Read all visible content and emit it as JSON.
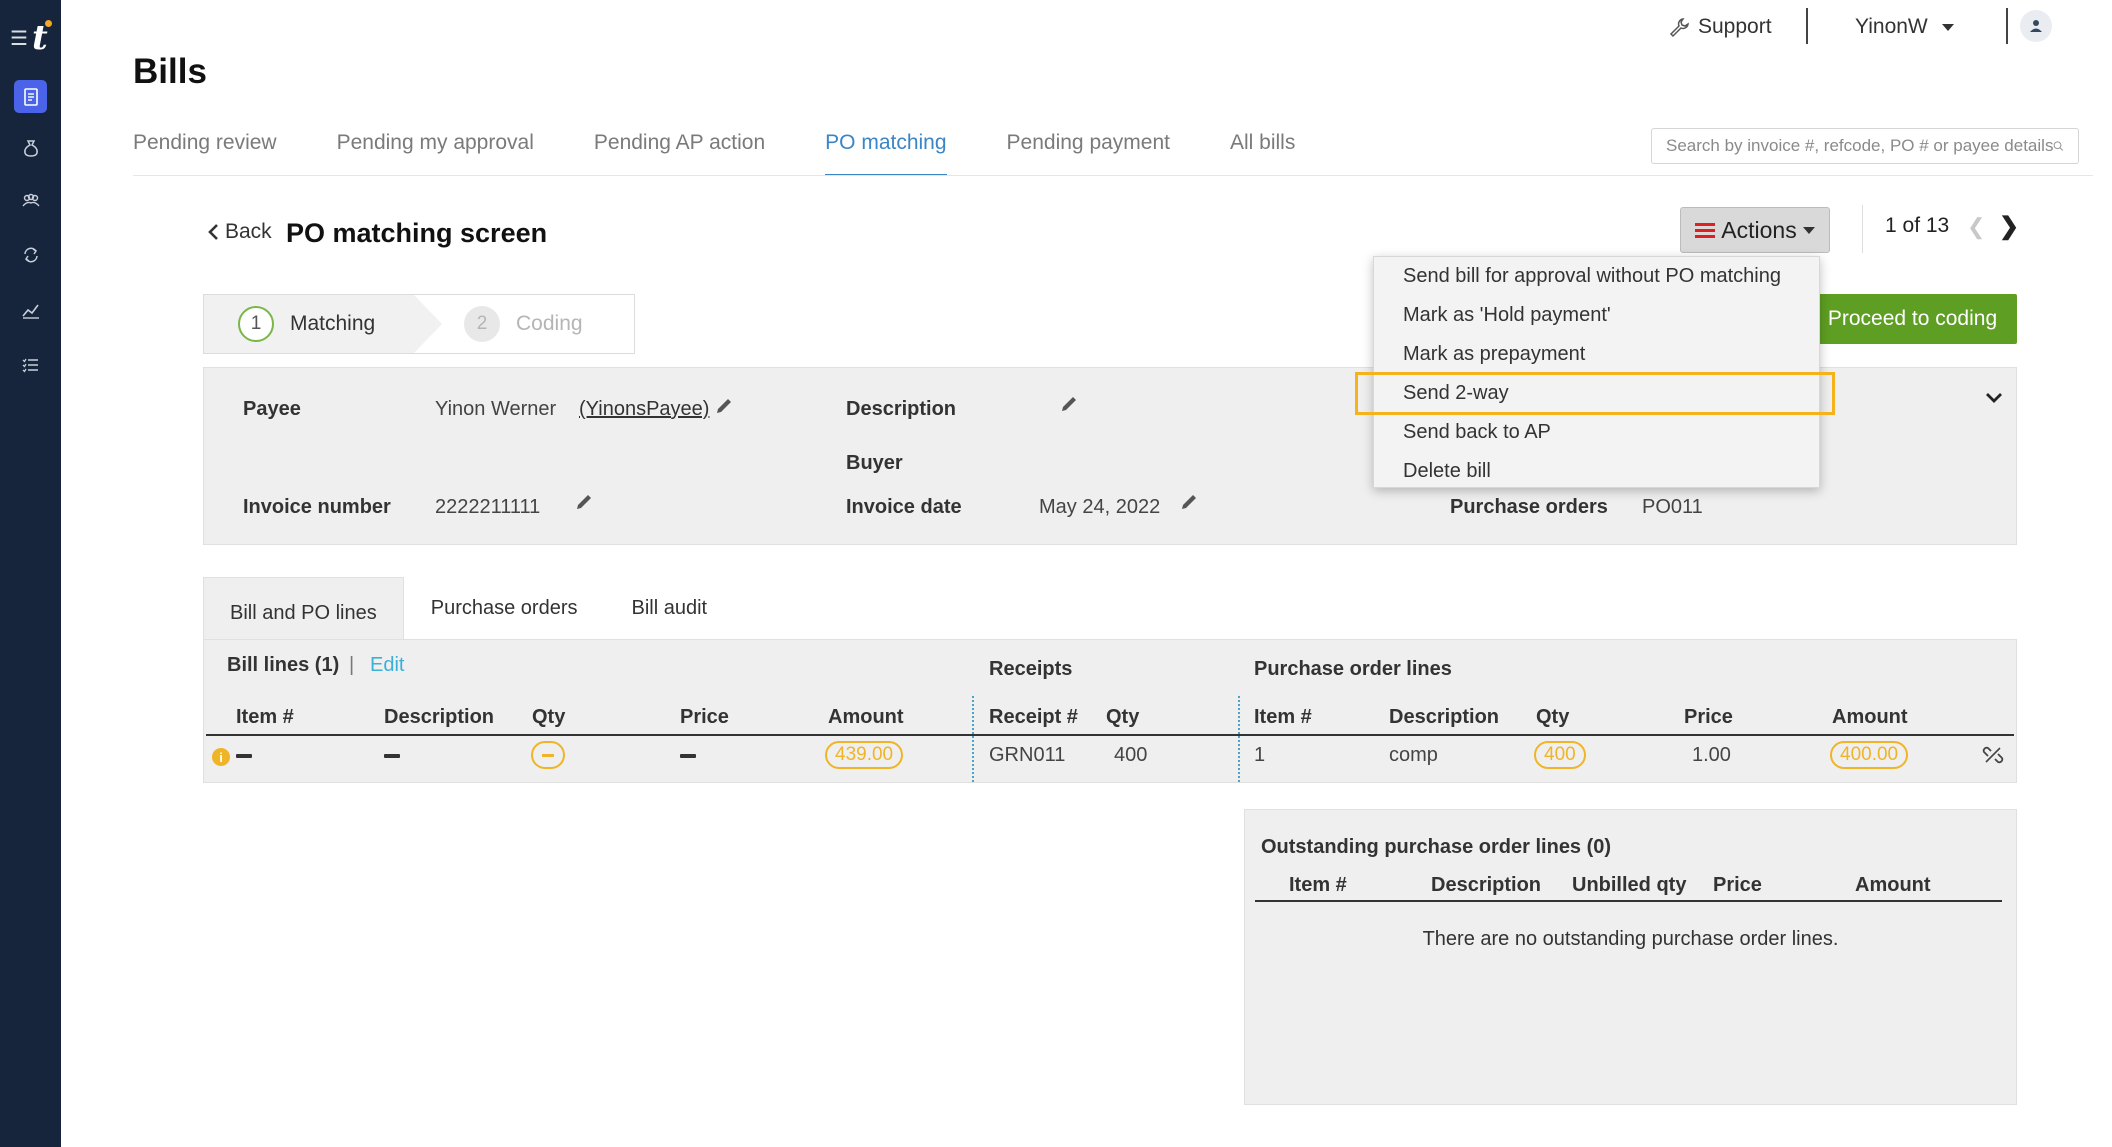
{
  "app": {
    "title": "Bills"
  },
  "header": {
    "support_label": "Support",
    "username": "YinonW"
  },
  "nav": {
    "items": [
      "bills",
      "payments",
      "payees",
      "sync",
      "reports",
      "tasks"
    ]
  },
  "tabs": [
    {
      "label": "Pending review",
      "active": false
    },
    {
      "label": "Pending my approval",
      "active": false
    },
    {
      "label": "Pending AP action",
      "active": false
    },
    {
      "label": "PO matching",
      "active": true
    },
    {
      "label": "Pending payment",
      "active": false
    },
    {
      "label": "All bills",
      "active": false
    }
  ],
  "search": {
    "placeholder": "Search by invoice #, refcode, PO # or payee details"
  },
  "subheader": {
    "back_label": "Back",
    "title": "PO matching screen",
    "actions_label": "Actions",
    "pager": "1 of 13"
  },
  "steps": [
    {
      "num": "1",
      "label": "Matching",
      "active": true
    },
    {
      "num": "2",
      "label": "Coding",
      "active": false
    }
  ],
  "proceed_label": "Proceed to coding",
  "details": {
    "payee_label": "Payee",
    "payee_name": "Yinon Werner",
    "payee_code": "(YinonsPayee)",
    "description_label": "Description",
    "buyer_label": "Buyer",
    "invoice_number_label": "Invoice number",
    "invoice_number": "2222211111",
    "invoice_date_label": "Invoice date",
    "invoice_date": "May 24, 2022",
    "purchase_orders_label": "Purchase orders",
    "purchase_orders": "PO011"
  },
  "lower_tabs": [
    {
      "label": "Bill and PO lines",
      "active": true
    },
    {
      "label": "Purchase orders",
      "active": false
    },
    {
      "label": "Bill audit",
      "active": false
    }
  ],
  "lines": {
    "bill_lines_title": "Bill lines (1)",
    "edit_label": "Edit",
    "receipts_title": "Receipts",
    "po_lines_title": "Purchase order lines",
    "bill_cols": [
      "Item #",
      "Description",
      "Qty",
      "Price",
      "Amount"
    ],
    "receipt_cols": [
      "Receipt #",
      "Qty"
    ],
    "po_cols": [
      "Item #",
      "Description",
      "Qty",
      "Price",
      "Amount"
    ],
    "row": {
      "bill_amount": "439.00",
      "receipt_no": "GRN011",
      "receipt_qty": "400",
      "po_item": "1",
      "po_description": "comp",
      "po_qty": "400",
      "po_price": "1.00",
      "po_amount": "400.00"
    }
  },
  "outstanding": {
    "title": "Outstanding purchase order lines (0)",
    "cols": [
      "Item #",
      "Description",
      "Unbilled qty",
      "Price",
      "Amount"
    ],
    "empty": "There are no outstanding purchase order lines."
  },
  "actions_menu": {
    "items": [
      "Send bill for approval without PO matching",
      "Mark as 'Hold payment'",
      "Mark as prepayment",
      "Send 2-way",
      "Send back to AP",
      "Delete bill"
    ],
    "highlighted": "Send 2-way"
  },
  "colors": {
    "accent": "#3a85c6",
    "proceed": "#5e9e22",
    "warning": "#f0b429",
    "highlight": "#f5b21b",
    "nav_bg": "#16253b"
  }
}
